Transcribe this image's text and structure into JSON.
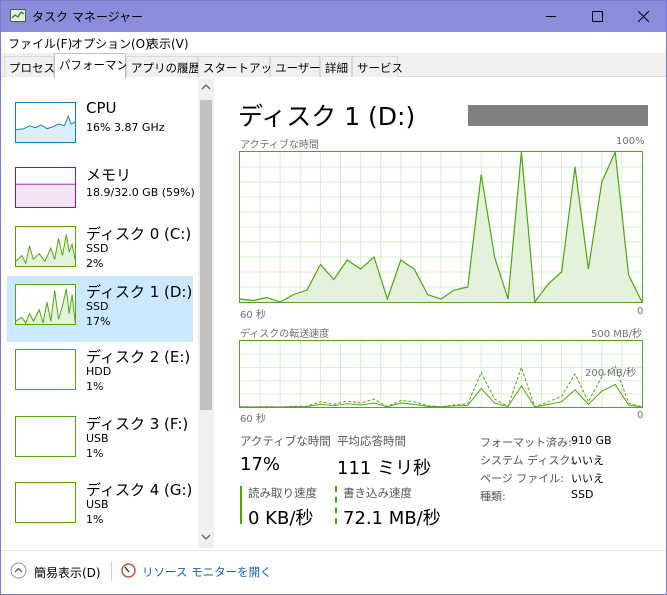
{
  "window": {
    "title": "タスク マネージャー"
  },
  "menu": [
    "ファイル(F)",
    "オプション(O)",
    "表示(V)"
  ],
  "tabs": [
    {
      "label": "プロセス",
      "active": false
    },
    {
      "label": "パフォーマンス",
      "active": true
    },
    {
      "label": "アプリの履歴",
      "active": false
    },
    {
      "label": "スタートアップ",
      "active": false
    },
    {
      "label": "ユーザー",
      "active": false
    },
    {
      "label": "詳細",
      "active": false
    },
    {
      "label": "サービス",
      "active": false
    }
  ],
  "devices": [
    {
      "name": "CPU",
      "line1": "16%  3.87 GHz",
      "line2": "",
      "color": "#117dbb",
      "selected": false
    },
    {
      "name": "メモリ",
      "line1": "18.9/32.0 GB (59%)",
      "line2": "",
      "color": "#8b12ae",
      "selected": false
    },
    {
      "name": "ディスク 0 (C:)",
      "line1": "SSD",
      "line2": "2%",
      "color": "#4da60c",
      "selected": false
    },
    {
      "name": "ディスク 1 (D:)",
      "line1": "SSD",
      "line2": "17%",
      "color": "#4da60c",
      "selected": true
    },
    {
      "name": "ディスク 2 (E:)",
      "line1": "HDD",
      "line2": "1%",
      "color": "#4da60c",
      "selected": false
    },
    {
      "name": "ディスク 3 (F:)",
      "line1": "USB",
      "line2": "1%",
      "color": "#4da60c",
      "selected": false
    },
    {
      "name": "ディスク 4 (G:)",
      "line1": "USB",
      "line2": "1%",
      "color": "#4da60c",
      "selected": false
    }
  ],
  "detail": {
    "title": "ディスク 1 (D:)",
    "graph1": {
      "label": "アクティブな時間",
      "max": "100%",
      "xleft": "60 秒",
      "xright": "0"
    },
    "graph2": {
      "label": "ディスクの転送速度",
      "max": "500 MB/秒",
      "mid": "200 MB/秒",
      "xleft": "60 秒",
      "xright": "0"
    },
    "stats": {
      "active_label": "アクティブな時間",
      "active_value": "17%",
      "resp_label": "平均応答時間",
      "resp_value": "111 ミリ秒",
      "read_label": "読み取り速度",
      "read_value": "0 KB/秒",
      "write_label": "書き込み速度",
      "write_value": "72.1 MB/秒"
    },
    "props": [
      {
        "k": "フォーマット済み:",
        "v": "910 GB"
      },
      {
        "k": "システム ディスク:",
        "v": "いいえ"
      },
      {
        "k": "ページ ファイル:",
        "v": "いいえ"
      },
      {
        "k": "種類:",
        "v": "SSD"
      }
    ]
  },
  "footer": {
    "fewer": "簡易表示(D)",
    "monitor": "リソース モニターを開く"
  },
  "chart_data": [
    {
      "type": "area",
      "title": "アクティブな時間",
      "xlabel_left": "60 秒",
      "xlabel_right": "0",
      "ylim": [
        0,
        100
      ],
      "x": [
        60,
        58,
        56,
        54,
        52,
        50,
        48,
        46,
        44,
        42,
        40,
        38,
        36,
        34,
        32,
        30,
        28,
        26,
        24,
        22,
        20,
        18,
        16,
        14,
        12,
        10,
        8,
        6,
        4,
        2,
        0
      ],
      "values": [
        2,
        1,
        3,
        0,
        5,
        8,
        25,
        15,
        28,
        22,
        30,
        2,
        28,
        22,
        5,
        2,
        8,
        10,
        85,
        30,
        2,
        100,
        0,
        12,
        20,
        90,
        22,
        80,
        100,
        18,
        0
      ]
    },
    {
      "type": "line",
      "title": "ディスクの転送速度",
      "xlabel_left": "60 秒",
      "xlabel_right": "0",
      "ylim": [
        0,
        500
      ],
      "series": [
        {
          "values": [
            2,
            1,
            2,
            0,
            4,
            6,
            40,
            20,
            45,
            30,
            60,
            3,
            50,
            40,
            10,
            3,
            15,
            25,
            260,
            60,
            5,
            300,
            0,
            40,
            80,
            250,
            40,
            230,
            310,
            30,
            0
          ]
        },
        {
          "values": [
            1,
            0,
            1,
            0,
            2,
            3,
            20,
            10,
            25,
            15,
            30,
            2,
            30,
            20,
            5,
            2,
            8,
            12,
            140,
            30,
            3,
            160,
            0,
            20,
            40,
            130,
            20,
            120,
            170,
            15,
            0
          ]
        }
      ]
    }
  ]
}
